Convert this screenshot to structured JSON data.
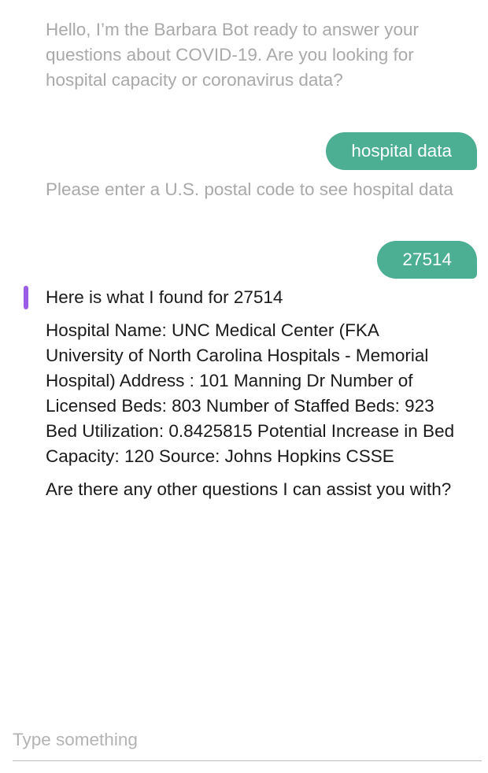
{
  "messages": {
    "bot_greeting": "Hello, I’m the Barbara Bot ready to answer your questions about COVID-19. Are you looking for hospital capacity or coronavirus data?",
    "user_choice": "hospital data",
    "bot_postal_prompt": "Please enter a U.S. postal code to see hospital data",
    "user_zip": "27514",
    "bot_result_intro": "Here is what I found for 27514",
    "bot_result_details": "Hospital Name: UNC Medical Center (FKA University of North Carolina Hospitals - Memorial Hospital) Address : 101 Manning Dr Number of Licensed Beds: 803 Number of Staffed Beds: 923 Bed Utilization: 0.8425815 Potential Increase in Bed Capacity: 120 Source: Johns Hopkins CSSE",
    "bot_followup": "Are there any other questions I can assist you with?"
  },
  "input": {
    "placeholder": "Type something",
    "value": ""
  },
  "colors": {
    "user_bubble": "#4caf94",
    "active_indicator": "#9b5de5",
    "inactive_text": "#a9a9a9",
    "active_text": "#1a1a1a"
  }
}
